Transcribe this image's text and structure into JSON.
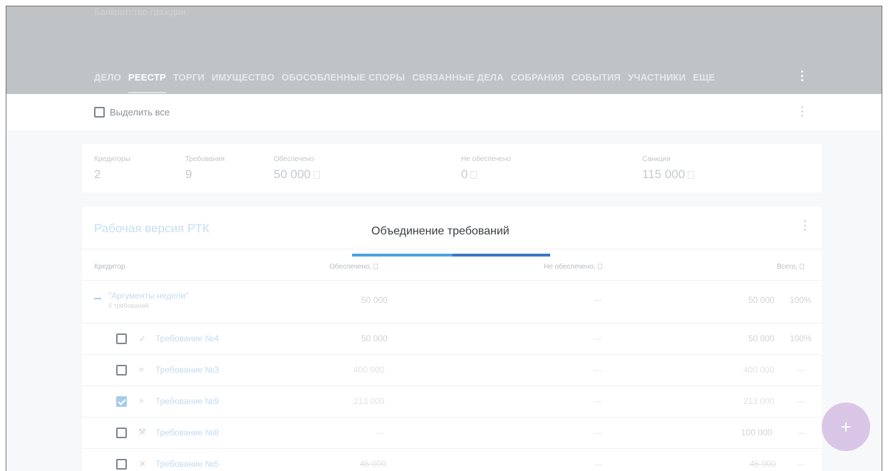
{
  "header": {
    "case_title": "Банкротство граждан",
    "tabs": [
      {
        "label": "ДЕЛО"
      },
      {
        "label": "РЕЕСТР"
      },
      {
        "label": "ТОРГИ"
      },
      {
        "label": "ИМУЩЕСТВО"
      },
      {
        "label": "ОБОСОБЛЕННЫЕ СПОРЫ"
      },
      {
        "label": "СВЯЗАННЫЕ ДЕЛА"
      },
      {
        "label": "СОБРАНИЯ"
      },
      {
        "label": "СОБЫТИЯ"
      },
      {
        "label": "УЧАСТНИКИ"
      },
      {
        "label": "ЕЩЕ"
      }
    ],
    "active_tab": "РЕЕСТР"
  },
  "toolbar": {
    "select_all_label": "Выделить все"
  },
  "summary": {
    "creditors_label": "Кредиторы",
    "creditors_value": "2",
    "claims_label": "Требования",
    "claims_value": "9",
    "secured_label": "Обеспечено",
    "secured_value": "50 000",
    "unsecured_label": "Не обеспечено",
    "unsecured_value": "0",
    "sanctions_label": "Санкции",
    "sanctions_value": "115 000"
  },
  "panel": {
    "title": "Рабочая версия РТК",
    "columns": {
      "creditor": "Кредитор",
      "secured": "Обеспечено,",
      "unsecured": "Не обеспечено,",
      "total": "Всего,"
    },
    "group": {
      "name": "\"Аргументы недели\"",
      "sub": "6 требований",
      "secured": "50 000",
      "unsecured": "—",
      "total": "50 000",
      "percent": "100%"
    },
    "rows": [
      {
        "icon": "✓",
        "icon_name": "check-icon",
        "name": "Требование №4",
        "secured": "50 000",
        "unsecured": "—",
        "total": "50 000",
        "percent": "100%",
        "checked": false,
        "strike": false
      },
      {
        "icon": "»",
        "icon_name": "double-chevron-icon",
        "name": "Требование №3",
        "secured": "400 000",
        "unsecured": "—",
        "total": "400 000",
        "percent": "—",
        "checked": false,
        "strike": false
      },
      {
        "icon": "»",
        "icon_name": "double-chevron-icon",
        "name": "Требование №9",
        "secured": "213 000",
        "unsecured": "—",
        "total": "213 000",
        "percent": "—",
        "checked": true,
        "strike": false
      },
      {
        "icon": "⚒",
        "icon_name": "hammer-icon",
        "name": "Требование №8",
        "secured": "—",
        "unsecured": "—",
        "total": "100 000",
        "percent": "—",
        "checked": false,
        "strike": false
      },
      {
        "icon": "✕",
        "icon_name": "cross-icon",
        "name": "Требование №5",
        "secured": "45 000",
        "unsecured": "—",
        "total": "45 000",
        "percent": "—",
        "checked": false,
        "strike": true
      }
    ]
  },
  "overlay": {
    "title": "Объединение требований"
  },
  "fab": {
    "label": "+"
  },
  "colors": {
    "header_bg": "#bfc3c6",
    "accent_blue": "#4ba3e0",
    "accent_dark_blue": "#3a78c2",
    "fab": "#d9c6e6"
  }
}
